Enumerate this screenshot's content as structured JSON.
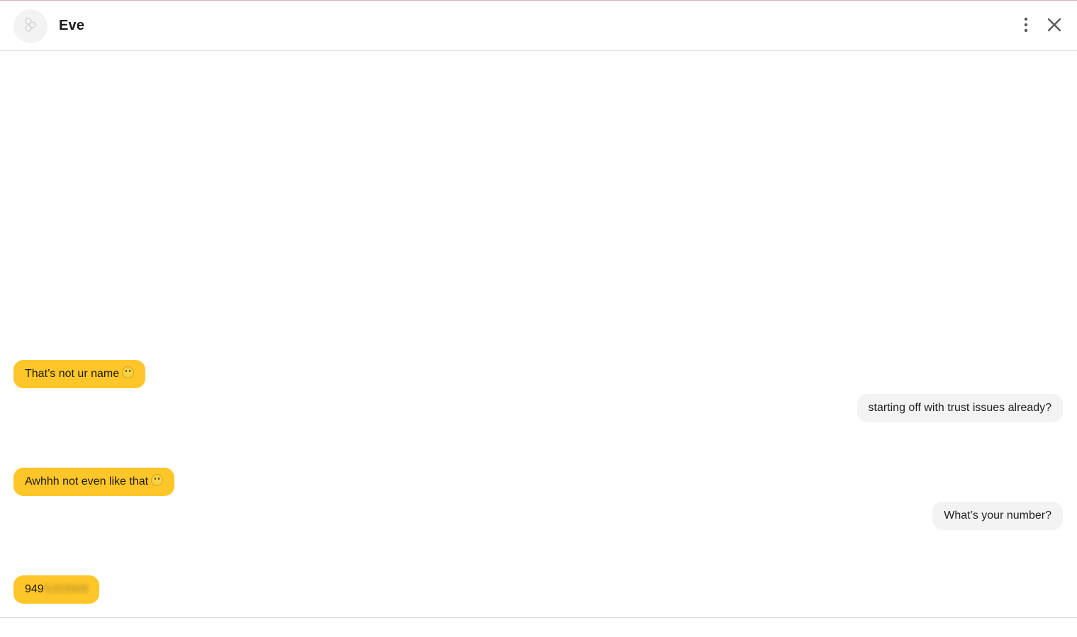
{
  "header": {
    "contact_name": "Eve",
    "avatar_icon": "bumble-logo-icon",
    "more_icon": "more-vertical-icon",
    "close_icon": "close-icon"
  },
  "colors": {
    "incoming_bubble": "#ffc629",
    "outgoing_bubble": "#f3f3f3",
    "divider": "#dcdcdc"
  },
  "messages": [
    {
      "direction": "incoming",
      "text": "That’s not ur name",
      "emoji": "thinking-face-icon"
    },
    {
      "direction": "outgoing",
      "text": "starting off with trust issues already?"
    },
    {
      "direction": "incoming",
      "text": "Awhhh not even like that",
      "emoji": "weary-face-icon"
    },
    {
      "direction": "outgoing",
      "text": "What’s your number?"
    },
    {
      "direction": "incoming",
      "text": "949",
      "redacted_text": "5203908"
    }
  ]
}
